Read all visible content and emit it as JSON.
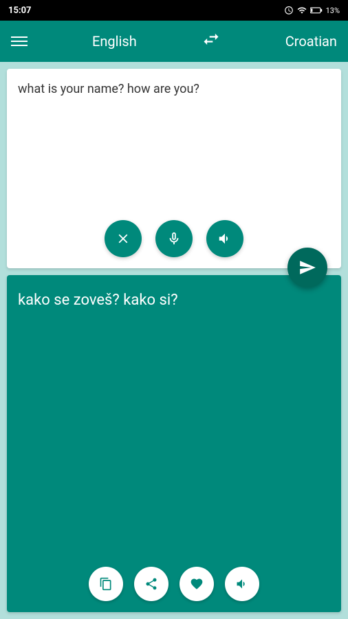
{
  "statusBar": {
    "time": "15:07",
    "batteryPercent": "13%"
  },
  "toolbar": {
    "menuLabel": "menu",
    "sourceLang": "English",
    "swapLabel": "swap languages",
    "targetLang": "Croatian"
  },
  "inputPanel": {
    "inputText": "what is your name? how are you?",
    "clearLabel": "clear",
    "micLabel": "microphone",
    "speakLabel": "speak",
    "sendLabel": "send"
  },
  "outputPanel": {
    "outputText": "kako se zoveš? kako si?",
    "copyLabel": "copy",
    "shareLabel": "share",
    "favoriteLabel": "favorite",
    "speakLabel": "speak output"
  }
}
